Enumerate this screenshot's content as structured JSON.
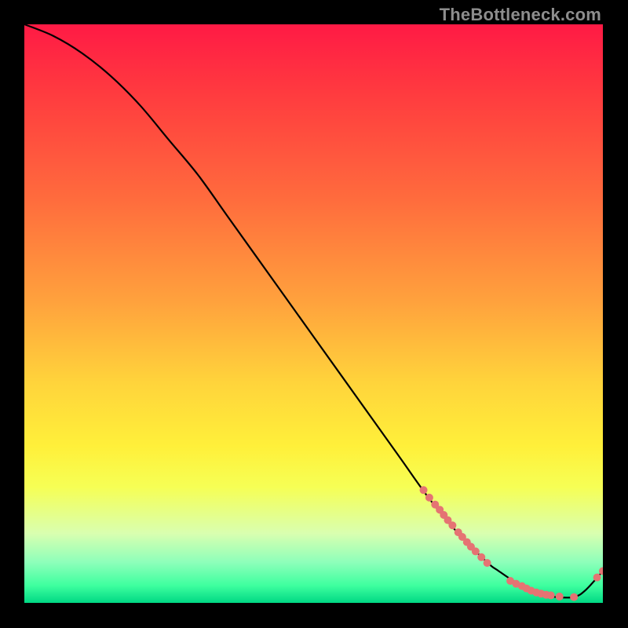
{
  "watermark": "TheBottleneck.com",
  "chart_data": {
    "type": "line",
    "title": "",
    "xlabel": "",
    "ylabel": "",
    "xlim": [
      0,
      100
    ],
    "ylim": [
      0,
      100
    ],
    "legend": false,
    "grid": false,
    "series": [
      {
        "name": "bottleneck-curve",
        "x": [
          0,
          5,
          10,
          15,
          20,
          25,
          30,
          35,
          40,
          45,
          50,
          55,
          60,
          65,
          70,
          75,
          80,
          82,
          85,
          88,
          90,
          92,
          95,
          97,
          100
        ],
        "y": [
          100,
          98,
          95,
          91,
          86,
          80,
          74,
          67,
          60,
          53,
          46,
          39,
          32,
          25,
          18,
          12,
          7,
          5.5,
          3.5,
          2,
          1.3,
          1,
          1,
          2.2,
          5.5
        ]
      }
    ],
    "marker_clusters": [
      {
        "name": "cluster-upper",
        "points_xy": [
          [
            69,
            19.5
          ],
          [
            70,
            18.2
          ],
          [
            71,
            17.0
          ],
          [
            71.8,
            16.1
          ],
          [
            72.5,
            15.2
          ],
          [
            73.2,
            14.3
          ],
          [
            74,
            13.4
          ],
          [
            75,
            12.2
          ],
          [
            75.7,
            11.4
          ],
          [
            76.5,
            10.5
          ],
          [
            77.2,
            9.7
          ],
          [
            78,
            8.9
          ],
          [
            79,
            7.9
          ],
          [
            80,
            6.9
          ]
        ],
        "color": "#e57373",
        "radius": 5
      },
      {
        "name": "cluster-lower",
        "points_xy": [
          [
            84,
            3.8
          ],
          [
            85,
            3.3
          ],
          [
            86,
            2.9
          ],
          [
            86.8,
            2.5
          ],
          [
            87.6,
            2.1
          ],
          [
            88.5,
            1.8
          ],
          [
            89.3,
            1.6
          ],
          [
            90.2,
            1.4
          ],
          [
            91,
            1.3
          ],
          [
            92.5,
            1.1
          ],
          [
            95,
            1.0
          ]
        ],
        "color": "#e57373",
        "radius": 5
      },
      {
        "name": "cluster-right-end",
        "points_xy": [
          [
            99,
            4.4
          ],
          [
            100,
            5.5
          ]
        ],
        "color": "#e57373",
        "radius": 5
      }
    ],
    "colors": {
      "line": "#000000",
      "markers": "#e57373",
      "bg_top": "#ff1a45",
      "bg_bottom": "#00d884",
      "page_bg": "#000000",
      "watermark": "#8d8d8d"
    }
  }
}
